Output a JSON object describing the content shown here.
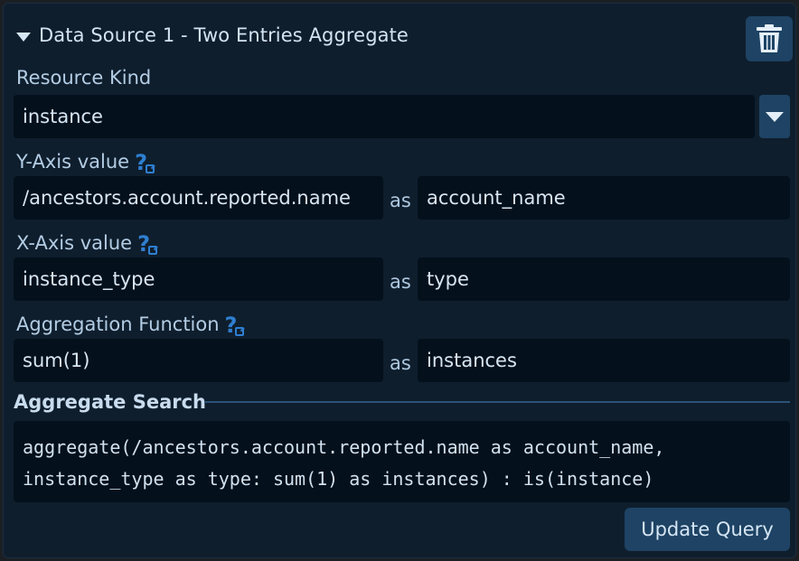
{
  "header": {
    "title": "Data Source 1 - Two Entries Aggregate"
  },
  "resource_kind": {
    "label": "Resource Kind",
    "value": "instance"
  },
  "y_axis": {
    "label": "Y-Axis value",
    "expression": "/ancestors.account.reported.name",
    "as_label": "as",
    "alias": "account_name"
  },
  "x_axis": {
    "label": "X-Axis value",
    "expression": "instance_type",
    "as_label": "as",
    "alias": "type"
  },
  "aggregation": {
    "label": "Aggregation Function",
    "expression": "sum(1)",
    "as_label": "as",
    "alias": "instances"
  },
  "aggregate_search": {
    "title": "Aggregate Search",
    "query_line1": "aggregate(/ancestors.account.reported.name as account_name,",
    "query_line2": "instance_type as type: sum(1) as instances) : is(instance)"
  },
  "actions": {
    "update_label": "Update Query"
  },
  "icons": {
    "collapse": "caret-down-icon",
    "delete": "trash-icon",
    "help": "help-external-icon",
    "dropdown": "chevron-down-icon"
  },
  "colors": {
    "panel_bg": "#0f1e2d",
    "field_bg": "#04101b",
    "button_bg": "#1e4364",
    "accent": "#2e7fd1"
  }
}
